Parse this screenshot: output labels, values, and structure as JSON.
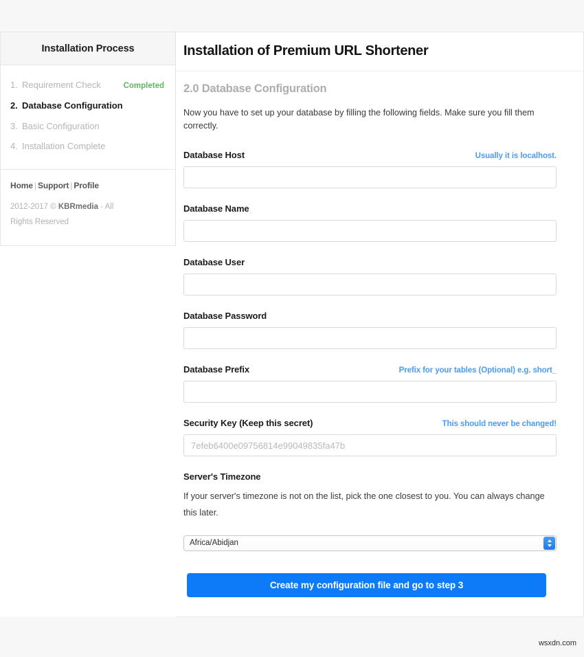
{
  "sidebar": {
    "header_title": "Installation Process",
    "steps": [
      {
        "num": "1.",
        "label": "Requirement Check",
        "badge": "Completed",
        "active": false
      },
      {
        "num": "2.",
        "label": "Database Configuration",
        "badge": "",
        "active": true
      },
      {
        "num": "3.",
        "label": "Basic Configuration",
        "badge": "",
        "active": false
      },
      {
        "num": "4.",
        "label": "Installation Complete",
        "badge": "",
        "active": false
      }
    ],
    "footer": {
      "link_home": "Home",
      "link_support": "Support",
      "link_profile": "Profile",
      "separator": "|",
      "copyright_prefix": "2012-2017 © ",
      "copyright_brand": "KBRmedia",
      "copyright_suffix": " - All Rights Reserved"
    }
  },
  "main": {
    "title": "Installation of Premium URL Shortener",
    "section_title": "2.0 Database Configuration",
    "intro": "Now you have to set up your database by filling the following fields. Make sure you fill them correctly.",
    "fields": [
      {
        "label": "Database Host",
        "hint": "Usually it is localhost.",
        "value": "",
        "placeholder": "",
        "readonly": false
      },
      {
        "label": "Database Name",
        "hint": "",
        "value": "",
        "placeholder": "",
        "readonly": false
      },
      {
        "label": "Database User",
        "hint": "",
        "value": "",
        "placeholder": "",
        "readonly": false
      },
      {
        "label": "Database Password",
        "hint": "",
        "value": "",
        "placeholder": "",
        "readonly": false
      },
      {
        "label": "Database Prefix",
        "hint": "Prefix for your tables (Optional) e.g. short_",
        "value": "",
        "placeholder": "",
        "readonly": false
      },
      {
        "label": "Security Key (Keep this secret)",
        "hint": "This should never be changed!",
        "value": "7efeb6400e09756814e99049835fa47b",
        "placeholder": "",
        "readonly": true
      }
    ],
    "timezone": {
      "label": "Server's Timezone",
      "description": "If your server's timezone is not on the list, pick the one closest to you. You can always change this later.",
      "selected": "Africa/Abidjan"
    },
    "submit_label": "Create my configuration file and go to step 3"
  },
  "watermark": "wsxdn.com",
  "colors": {
    "accent_blue": "#0d7bf7",
    "hint_blue": "#4b9cf0",
    "success_green": "#5cb85c",
    "page_bg": "#f7f7f7"
  }
}
